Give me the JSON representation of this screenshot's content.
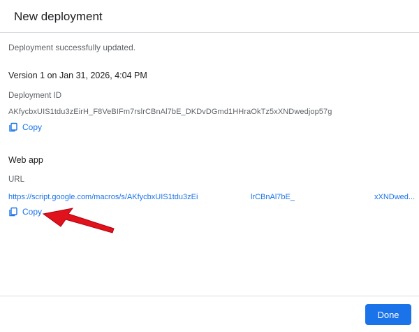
{
  "dialog": {
    "title": "New deployment",
    "status": "Deployment successfully updated.",
    "version": "Version 1 on Jan 31, 2026, 4:04 PM",
    "deployment_id_label": "Deployment ID",
    "deployment_id": "AKfycbxUIS1tdu3zEirH_F8VeBIFm7rslrCBnAl7bE_DKDvDGmd1HHraOkTz5xXNDwedjop57g",
    "copy_label": "Copy",
    "web_app_title": "Web app",
    "url_label": "URL",
    "url_part1": "https://script.google.com/macros/s/AKfycbxUIS1tdu3zEi",
    "url_part2": "lrCBnAl7bE_",
    "url_part3": "xXNDwed...",
    "done_label": "Done"
  },
  "colors": {
    "accent": "#1a73e8",
    "arrow": "#e0121b"
  },
  "icons": {
    "copy": "copy-icon",
    "annotation": "red-arrow"
  }
}
